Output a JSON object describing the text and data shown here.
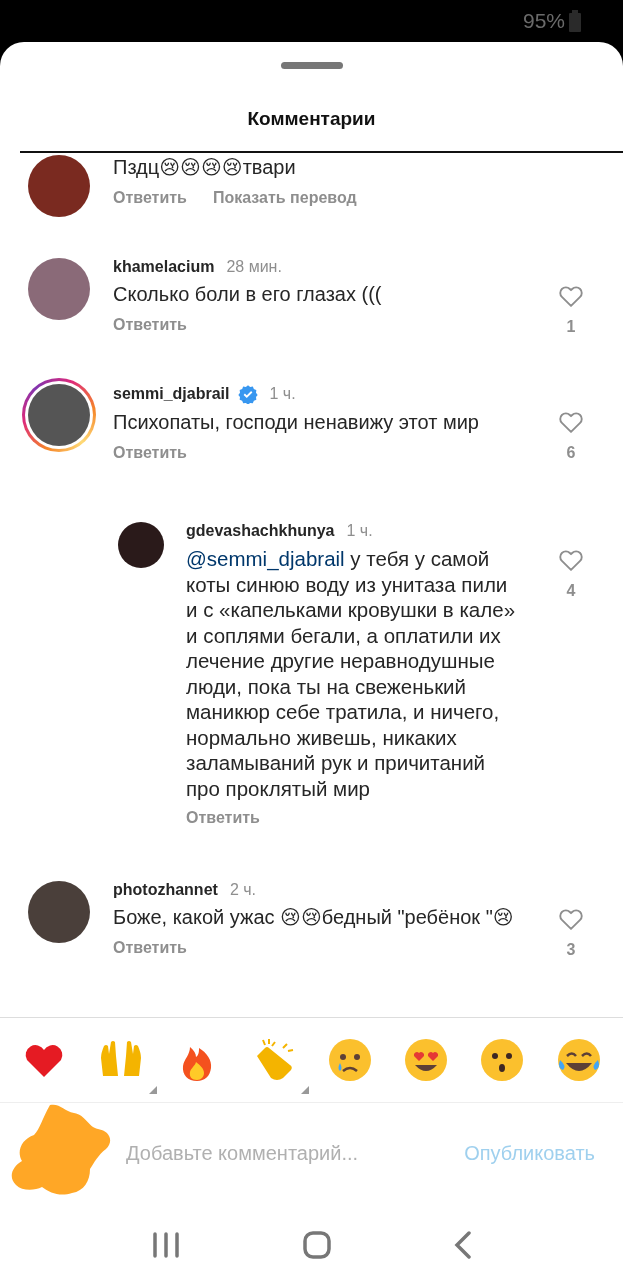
{
  "status_bar": {
    "battery": "95%"
  },
  "sheet": {
    "title": "Комментарии"
  },
  "comments": [
    {
      "kind": "comment",
      "text": "Пздц😢😢😢😢твари",
      "verified": false,
      "story_ring": false,
      "actions": [
        "Ответить",
        "Показать перевод"
      ]
    },
    {
      "kind": "comment",
      "username": "khamelacium",
      "time": "28 мин.",
      "text": "Сколько боли в его глазах (((",
      "verified": false,
      "story_ring": false,
      "likes": "1",
      "actions": [
        "Ответить"
      ]
    },
    {
      "kind": "comment",
      "username": "semmi_djabrail",
      "time": "1 ч.",
      "text": "Психопаты, господи ненавижу этот мир",
      "verified": true,
      "story_ring": true,
      "likes": "6",
      "actions": [
        "Ответить"
      ]
    },
    {
      "kind": "reply",
      "username": "gdevashachkhunya",
      "time": "1 ч.",
      "mention": "@semmi_djabrail",
      "text": " у тебя у самой коты синюю воду из унитаза пили и с «капельками кровушки в кале» и соплями бегали, а оплатили их лечение другие неравнодушные люди, пока ты на свеженький маникюр себе тратила, и ничего, нормально живешь, никаких заламываний рук и причитаний про проклятый мир",
      "verified": false,
      "story_ring": false,
      "likes": "4",
      "actions": [
        "Ответить"
      ]
    },
    {
      "kind": "comment",
      "username": "photozhannet",
      "time": "2 ч.",
      "text": "Боже, какой ужас 😢😢бедный \"ребёнок \"😢",
      "verified": false,
      "story_ring": false,
      "likes": "3",
      "actions": [
        "Ответить"
      ]
    }
  ],
  "composer": {
    "placeholder": "Добавьте комментарий...",
    "post_button": "Опубликовать"
  }
}
